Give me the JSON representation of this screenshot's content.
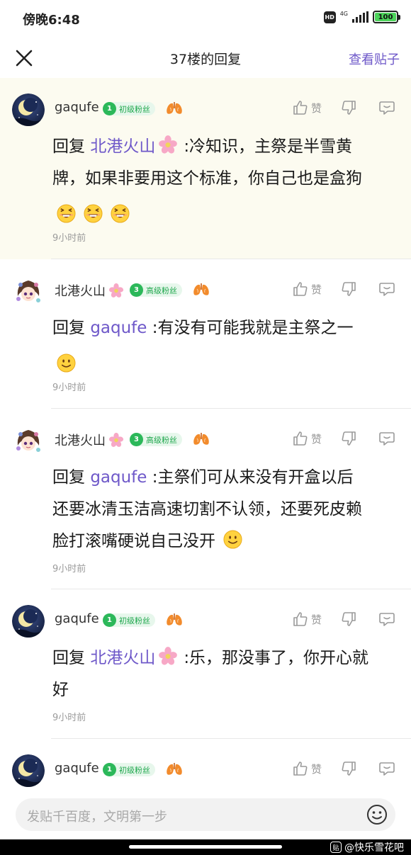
{
  "status_bar": {
    "time": "傍晚6:48",
    "hd": "HD",
    "network": "4G",
    "battery": "100"
  },
  "nav": {
    "title": "37楼的回复",
    "action": "查看贴子"
  },
  "replies": [
    {
      "username": "gaqufe",
      "level": "1",
      "badge": "初级粉丝",
      "like_label": "赞",
      "reply_prefix": "回复",
      "mention": "北港火山",
      "line1": ":冷知识，主祭是半雪黄",
      "line2": "牌，如果非要用这个标准，你自己也是盒狗",
      "time": "9小时前"
    },
    {
      "username": "北港火山",
      "level": "3",
      "badge": "高级粉丝",
      "like_label": "赞",
      "reply_prefix": "回复",
      "mention": "gaqufe",
      "line1": ":有没有可能我就是主祭之一",
      "time": "9小时前"
    },
    {
      "username": "北港火山",
      "level": "3",
      "badge": "高级粉丝",
      "like_label": "赞",
      "reply_prefix": "回复",
      "mention": "gaqufe",
      "line1": ":主祭们可从来没有开盒以后",
      "line2": "还要冰清玉洁高速切割不认领，还要死皮赖",
      "line3": "脸打滚嘴硬说自己没开",
      "time": "9小时前"
    },
    {
      "username": "gaqufe",
      "level": "1",
      "badge": "初级粉丝",
      "like_label": "赞",
      "reply_prefix": "回复",
      "mention": "北港火山",
      "line1": ":乐，那没事了，你开心就",
      "line2": "好",
      "time": "9小时前"
    },
    {
      "username": "gaqufe",
      "level": "1",
      "badge": "初级粉丝",
      "like_label": "赞"
    }
  ],
  "input": {
    "placeholder": "发贴千百度，文明第一步"
  },
  "watermark": {
    "logo": "贴",
    "text": "@快乐雪花吧"
  },
  "colors": {
    "accent": "#6e58c9",
    "badge_green": "#2cb85a",
    "highlight_bg": "#fcfbf0",
    "meta_gray": "#9b9b9b"
  },
  "icons": [
    "close-icon",
    "thumbs-up-icon",
    "thumbs-down-icon",
    "comment-icon",
    "smile-icon",
    "lung-icon",
    "blossom-icon",
    "emoji-laugh-icon",
    "emoji-smile-icon"
  ]
}
